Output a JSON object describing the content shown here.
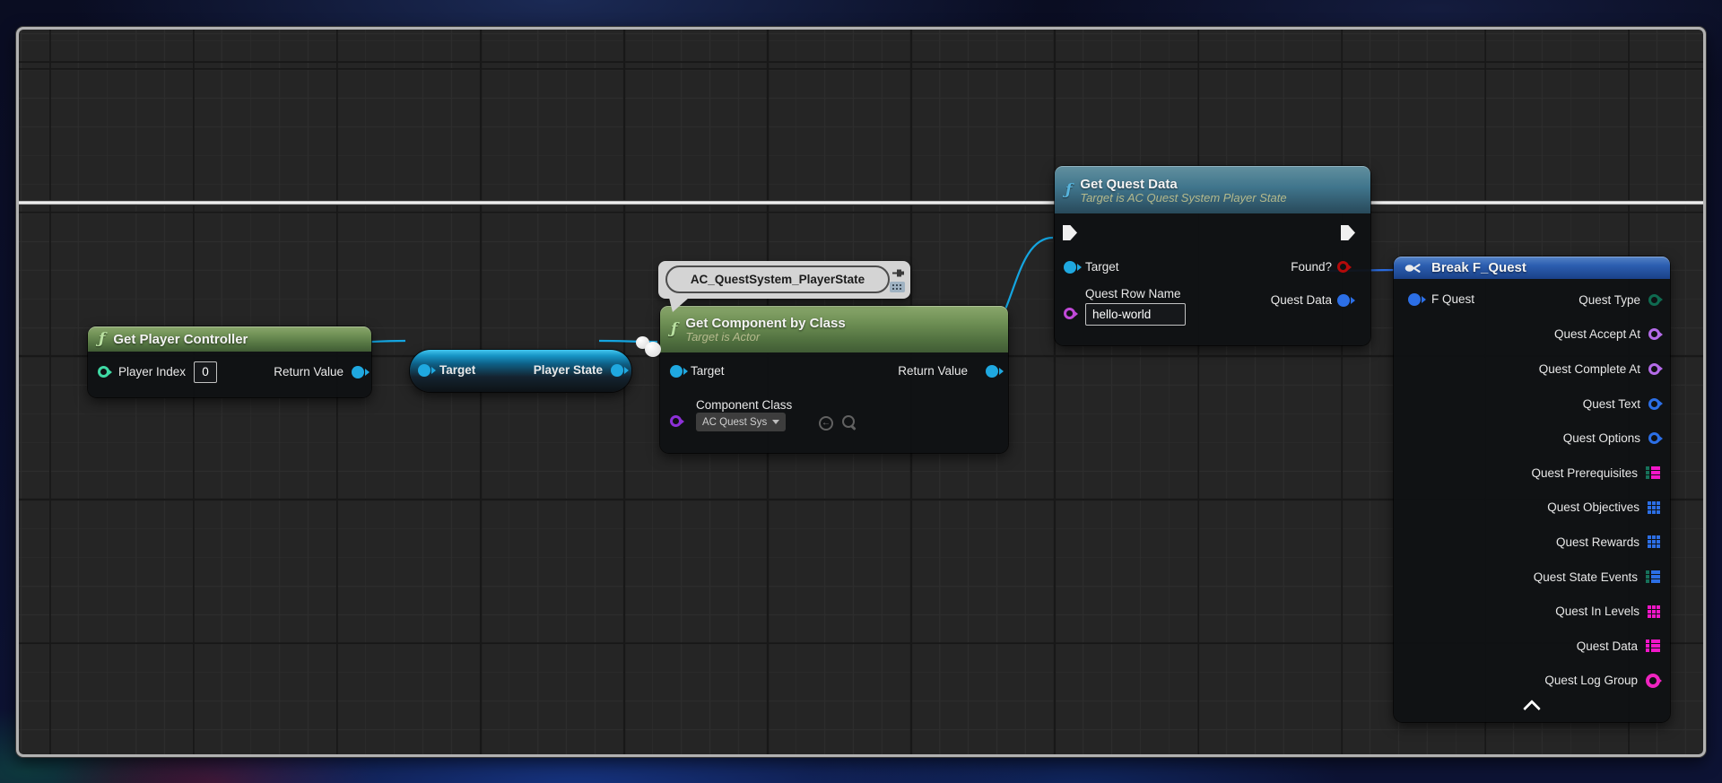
{
  "icons": {
    "function_glyph": "ƒ",
    "use_asset_glyph": "←"
  },
  "colors": {
    "exec_wire": "#ededed",
    "object_wire": "#14a5e0",
    "struct_wire": "#2c6fe6",
    "header_green": "#6f9055",
    "header_teal": "#40758c",
    "header_blue": "#2c5eb0",
    "int_pin": "#3fd9a4",
    "class_pin": "#8d30d8",
    "name_pin": "#c149d8",
    "bool_pin": "#b40a0a",
    "enum_pin": "#0f6a50",
    "text_pin": "#2c6fe6",
    "tag_pin": "#ef24c0",
    "string_container": "#f216c8"
  },
  "comment_bubble": {
    "text": "AC_QuestSystem_PlayerState"
  },
  "nodes": {
    "get_player_controller": {
      "title": "Get Player Controller",
      "player_index_label": "Player Index",
      "player_index_value": "0",
      "return_value_label": "Return Value"
    },
    "get_player_state": {
      "target_label": "Target",
      "player_state_label": "Player State"
    },
    "get_component_by_class": {
      "title": "Get Component by Class",
      "subtitle": "Target is Actor",
      "target_label": "Target",
      "return_value_label": "Return Value",
      "component_class_label": "Component Class",
      "component_class_value": "AC Quest Systen"
    },
    "get_quest_data": {
      "title": "Get Quest Data",
      "subtitle": "Target is AC Quest System Player State",
      "target_label": "Target",
      "found_label": "Found?",
      "quest_row_name_label": "Quest Row Name",
      "quest_row_name_value": "hello-world",
      "quest_data_label": "Quest Data"
    },
    "break_f_quest": {
      "title": "Break F_Quest",
      "f_quest_label": "F Quest",
      "outputs": [
        {
          "label": "Quest Type",
          "pin": "ring",
          "cls": "ring-enum"
        },
        {
          "label": "Quest Accept At",
          "pin": "ring",
          "cls": "ring-violet"
        },
        {
          "label": "Quest Complete At",
          "pin": "ring",
          "cls": "ring-violet"
        },
        {
          "label": "Quest Text",
          "pin": "ring",
          "cls": "ring-blue"
        },
        {
          "label": "Quest Options",
          "pin": "ring",
          "cls": "ring-blue"
        },
        {
          "label": "Quest Prerequisites",
          "pin": "map",
          "cls": "map-teal-magenta"
        },
        {
          "label": "Quest Objectives",
          "pin": "grid",
          "cls": "array-blue"
        },
        {
          "label": "Quest Rewards",
          "pin": "grid",
          "cls": "array-blue"
        },
        {
          "label": "Quest State Events",
          "pin": "map",
          "cls": "map-teal-blue"
        },
        {
          "label": "Quest In Levels",
          "pin": "grid",
          "cls": "array-magenta"
        },
        {
          "label": "Quest Data",
          "pin": "map",
          "cls": "map-magenta"
        },
        {
          "label": "Quest Log Group",
          "pin": "bigring",
          "cls": "ring-tag"
        }
      ]
    }
  }
}
